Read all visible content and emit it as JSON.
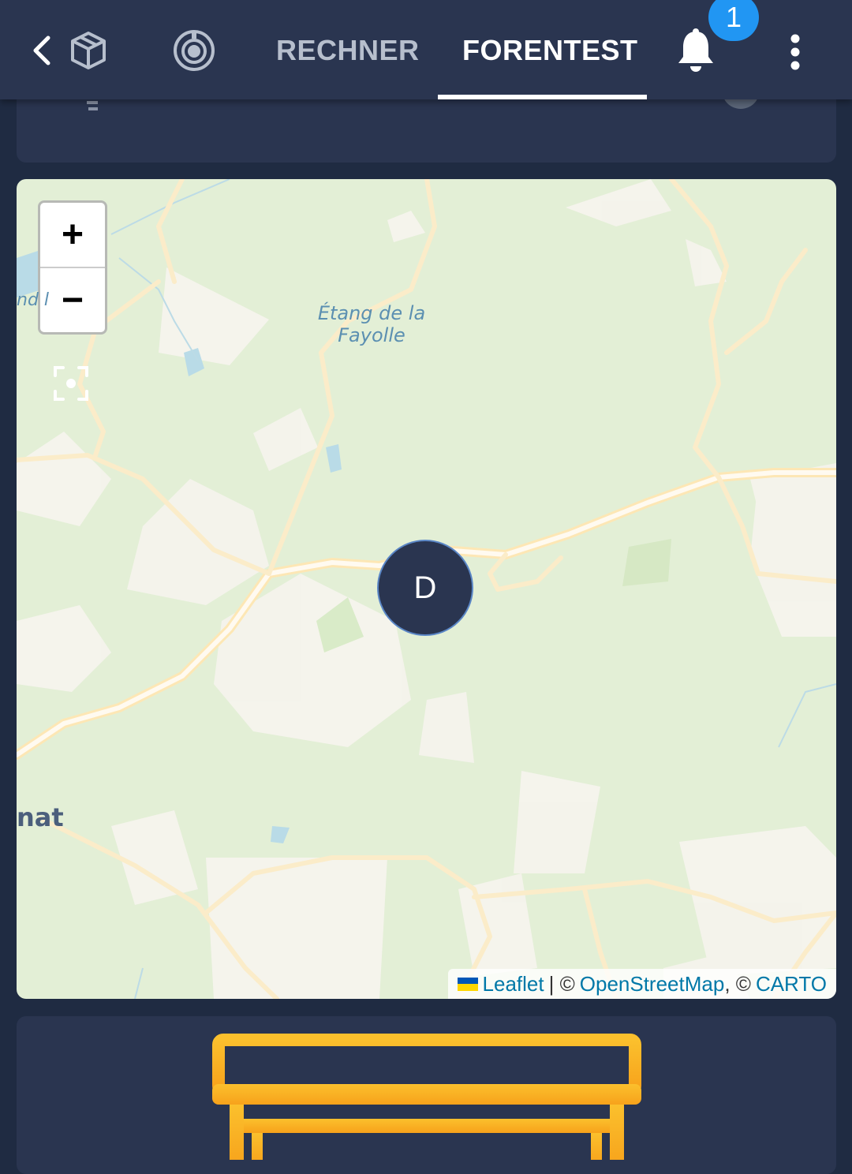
{
  "header": {
    "back_icon": "chevron-left-icon",
    "cube_icon": "cube-icon",
    "target_icon": "target-icon",
    "tabs": [
      {
        "label": "RECHNER",
        "active": false
      },
      {
        "label": "FORENTEST",
        "active": true
      }
    ],
    "notifications": {
      "icon": "bell-icon",
      "count": "1",
      "badge_color": "#2196f3"
    },
    "more_icon": "more-vertical-icon"
  },
  "map": {
    "zoom_in_label": "+",
    "zoom_out_label": "−",
    "locate_icon": "locate-icon",
    "labels": {
      "lake": "Étang de la Fayolle",
      "town": "nat",
      "left_edge": "nd l"
    },
    "marker": {
      "label": "D",
      "color": "#2a3550"
    },
    "attribution": {
      "leaflet": "Leaflet",
      "sep1": "| ©",
      "osm": "OpenStreetMap",
      "sep2": ", ©",
      "carto": "CARTO"
    }
  },
  "bottom_card": {
    "icon": "bench-icon",
    "accent_color": "#fbc02d"
  },
  "colors": {
    "background": "#1f2b42",
    "bar": "#2a3550",
    "map_green": "#e3efd6",
    "road": "#fff6dd"
  }
}
